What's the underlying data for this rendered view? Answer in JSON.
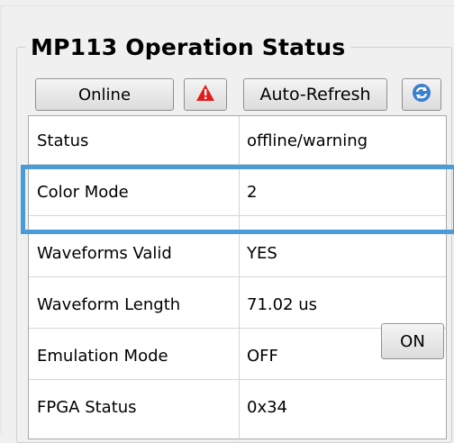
{
  "panel": {
    "title": "MP113 Operation Status"
  },
  "toolbar": {
    "online_label": "Online",
    "warning_icon": "warning-triangle-icon",
    "auto_refresh_label": "Auto-Refresh",
    "refresh_icon": "refresh-icon"
  },
  "table": {
    "rows": [
      {
        "label": "Status",
        "value": "offline/warning"
      },
      {
        "label": "Color Mode",
        "value": "2"
      },
      {
        "label": "Waveforms Valid",
        "value": "YES"
      },
      {
        "label": "Waveform Length",
        "value": "71.02 us"
      },
      {
        "label": "Emulation Mode",
        "value": "OFF"
      },
      {
        "label": "FPGA Status",
        "value": "0x34"
      }
    ],
    "emulation_button_label": "ON"
  },
  "colors": {
    "warning_red": "#e21b1b",
    "highlight_blue": "#4a9bd8",
    "refresh_blue": "#3a7fd0"
  }
}
